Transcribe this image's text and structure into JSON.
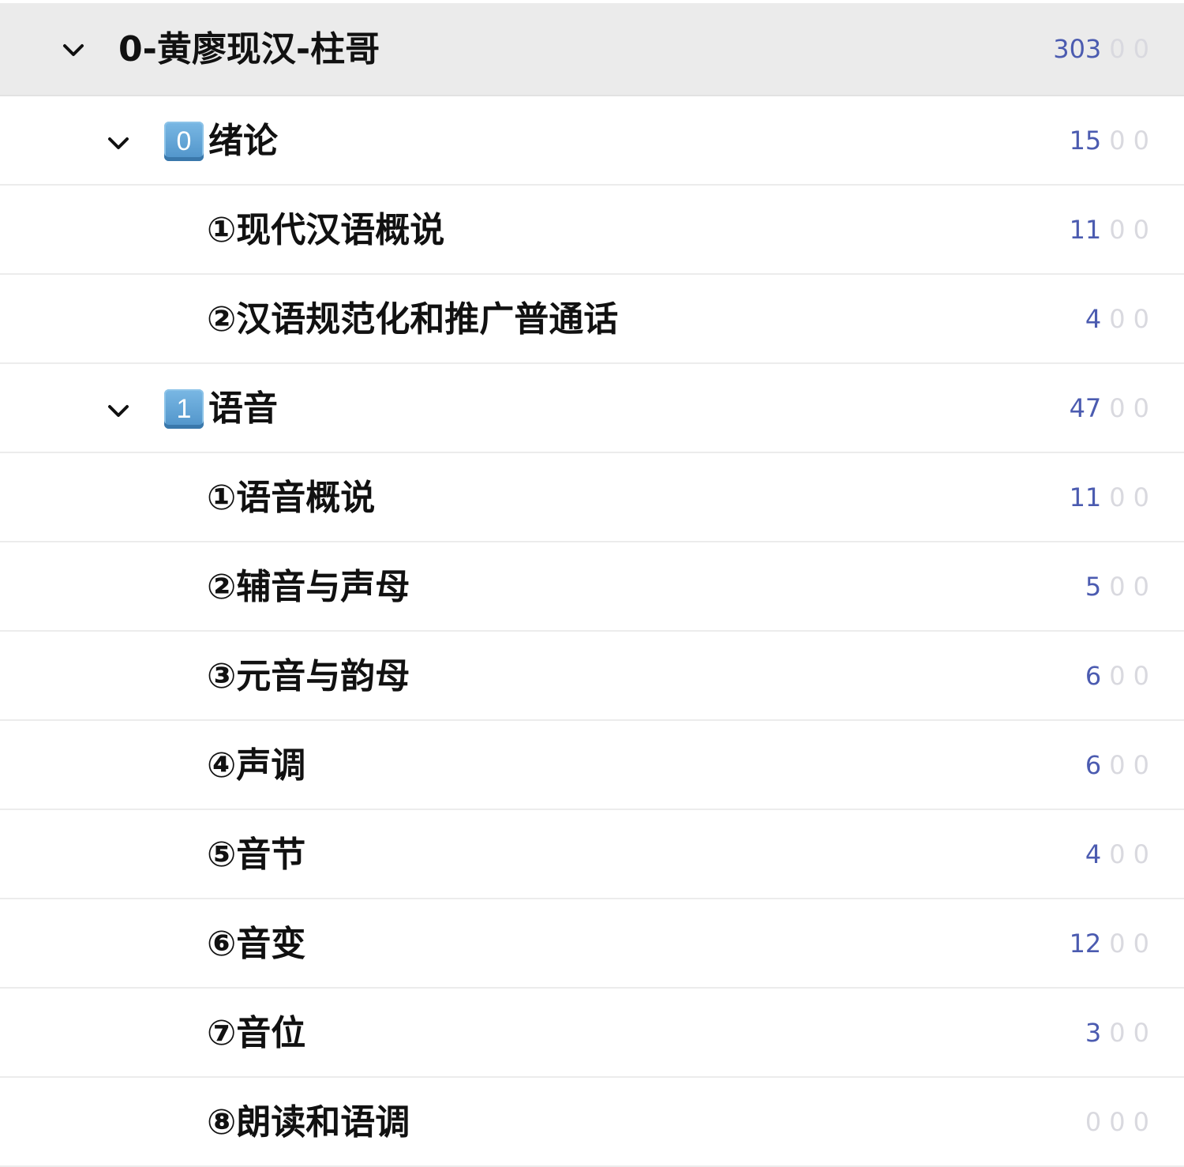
{
  "colors": {
    "root_row_bg": "#ebebeb",
    "count_new": "#4b5bb0",
    "count_zero": "#d9d9df",
    "divider": "#ececec",
    "keycap": "#5a9fd4"
  },
  "decks": {
    "root": {
      "name": "0-黄廖现汉-柱哥",
      "counts": {
        "new": "303",
        "learn": "0",
        "due": "0"
      },
      "expanded": true
    },
    "ch0": {
      "badge": "0",
      "name": "绪论",
      "counts": {
        "new": "15",
        "learn": "0",
        "due": "0"
      },
      "expanded": true,
      "items": [
        {
          "name": "①现代汉语概说",
          "counts": {
            "new": "11",
            "learn": "0",
            "due": "0"
          }
        },
        {
          "name": "②汉语规范化和推广普通话",
          "counts": {
            "new": "4",
            "learn": "0",
            "due": "0"
          }
        }
      ]
    },
    "ch1": {
      "badge": "1",
      "name": "语音",
      "counts": {
        "new": "47",
        "learn": "0",
        "due": "0"
      },
      "expanded": true,
      "items": [
        {
          "name": "①语音概说",
          "counts": {
            "new": "11",
            "learn": "0",
            "due": "0"
          }
        },
        {
          "name": "②辅音与声母",
          "counts": {
            "new": "5",
            "learn": "0",
            "due": "0"
          }
        },
        {
          "name": "③元音与韵母",
          "counts": {
            "new": "6",
            "learn": "0",
            "due": "0"
          }
        },
        {
          "name": "④声调",
          "counts": {
            "new": "6",
            "learn": "0",
            "due": "0"
          }
        },
        {
          "name": "⑤音节",
          "counts": {
            "new": "4",
            "learn": "0",
            "due": "0"
          }
        },
        {
          "name": "⑥音变",
          "counts": {
            "new": "12",
            "learn": "0",
            "due": "0"
          }
        },
        {
          "name": "⑦音位",
          "counts": {
            "new": "3",
            "learn": "0",
            "due": "0"
          }
        },
        {
          "name": "⑧朗读和语调",
          "counts": {
            "new": "0",
            "learn": "0",
            "due": "0"
          }
        }
      ]
    }
  }
}
